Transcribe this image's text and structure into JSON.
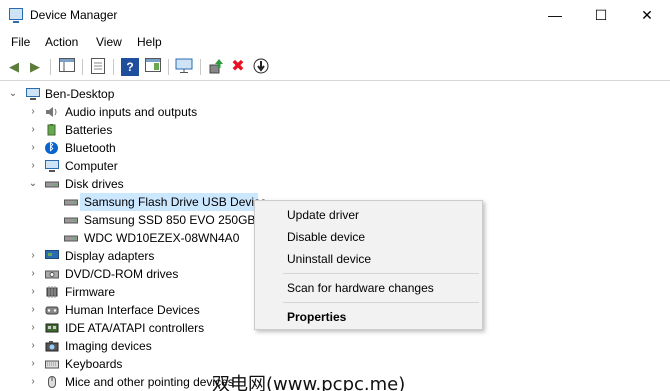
{
  "window": {
    "title": "Device Manager",
    "minimize_glyph": "—",
    "maximize_glyph": "☐",
    "close_glyph": "✕"
  },
  "menu": [
    "File",
    "Action",
    "View",
    "Help"
  ],
  "toolbar_icons": [
    "back-arrow-icon",
    "forward-arrow-icon",
    "show-hide-console-tree-icon",
    "properties-icon",
    "help-icon",
    "action-pane-icon",
    "monitor-icon",
    "update-driver-icon",
    "uninstall-icon",
    "download-icon"
  ],
  "tree": {
    "root": "Ben-Desktop",
    "categories": [
      {
        "label": "Audio inputs and outputs",
        "icon": "speaker-icon"
      },
      {
        "label": "Batteries",
        "icon": "battery-icon"
      },
      {
        "label": "Bluetooth",
        "icon": "bluetooth-icon"
      },
      {
        "label": "Computer",
        "icon": "computer-icon"
      },
      {
        "label": "Disk drives",
        "icon": "disk-drive-icon",
        "expanded": true,
        "children": [
          "Samsung Flash Drive USB Device",
          "Samsung SSD 850 EVO 250GB",
          "WDC WD10EZEX-08WN4A0"
        ]
      },
      {
        "label": "Display adapters",
        "icon": "display-adapter-icon"
      },
      {
        "label": "DVD/CD-ROM drives",
        "icon": "dvd-icon"
      },
      {
        "label": "Firmware",
        "icon": "firmware-icon"
      },
      {
        "label": "Human Interface Devices",
        "icon": "hid-icon"
      },
      {
        "label": "IDE ATA/ATAPI controllers",
        "icon": "ide-controller-icon"
      },
      {
        "label": "Imaging devices",
        "icon": "camera-icon"
      },
      {
        "label": "Keyboards",
        "icon": "keyboard-icon"
      },
      {
        "label": "Mice and other pointing devices",
        "icon": "mouse-icon"
      }
    ],
    "selected": "Samsung Flash Drive USB Device"
  },
  "context_menu": {
    "items": [
      "Update driver",
      "Disable device",
      "Uninstall device",
      "Scan for hardware changes",
      "Properties"
    ]
  },
  "watermark": "双电网(www.pcpc.me)",
  "colors": {
    "selection": "#cce8ff",
    "context_bg": "#f2f2f2",
    "uninstall_red": "#e81123",
    "help_blue": "#1f4e9c",
    "bluetooth_blue": "#0a64d0"
  }
}
